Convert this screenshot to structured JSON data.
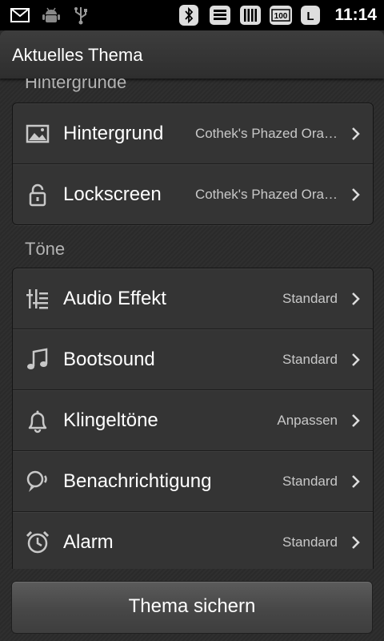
{
  "status_bar": {
    "time": "11:14",
    "battery_level": "100",
    "icons": [
      "mail-icon",
      "android-debug-icon",
      "usb-icon",
      "bluetooth-icon",
      "data-icon",
      "signal-icon",
      "battery-icon",
      "lock-icon"
    ]
  },
  "title_bar": {
    "title": "Aktuelles Thema"
  },
  "sections": {
    "wallpapers": {
      "header": "Hintergründe",
      "rows": [
        {
          "label": "Hintergrund",
          "value": "Cothek's Phazed Ora…",
          "icon": "image-icon"
        },
        {
          "label": "Lockscreen",
          "value": "Cothek's Phazed Ora…",
          "icon": "lock-icon"
        }
      ]
    },
    "tones": {
      "header": "Töne",
      "rows": [
        {
          "label": "Audio Effekt",
          "value": "Standard",
          "icon": "equalizer-icon"
        },
        {
          "label": "Bootsound",
          "value": "Standard",
          "icon": "music-note-icon"
        },
        {
          "label": "Klingeltöne",
          "value": "Anpassen",
          "icon": "bell-icon"
        },
        {
          "label": "Benachrichtigung",
          "value": "Standard",
          "icon": "notification-speaker-icon"
        },
        {
          "label": "Alarm",
          "value": "Standard",
          "icon": "alarm-clock-icon"
        }
      ]
    }
  },
  "footer": {
    "save_label": "Thema sichern"
  }
}
